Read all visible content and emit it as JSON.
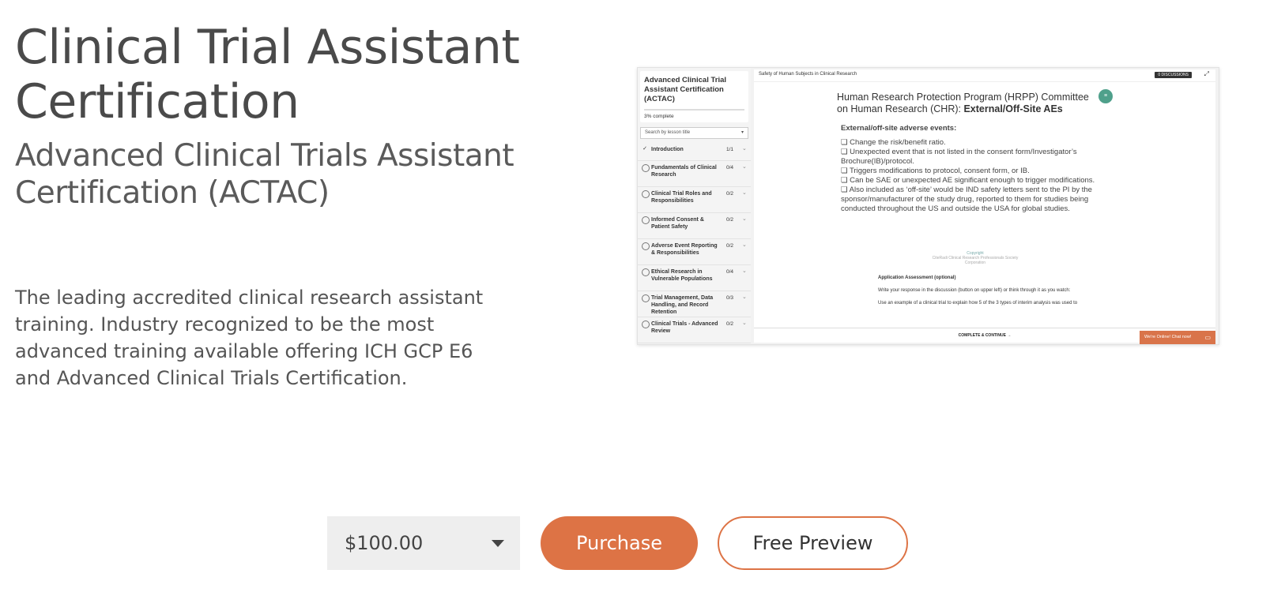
{
  "course": {
    "title": "Clinical Trial Assistant Certification",
    "subtitle": "Advanced Clinical Trials Assistant Certification (ACTAC)",
    "description": "The leading accredited clinical research assistant training. Industry recognized to be the most advanced training available offering ICH GCP E6 and Advanced Clinical Trials Certification."
  },
  "preview": {
    "sidebar_title": "Advanced Clinical Trial Assistant Certification (ACTAC)",
    "progress": "3% complete",
    "search_placeholder": "Search by lesson title",
    "lessons": [
      {
        "title": "Introduction",
        "count": "1/1",
        "done": true
      },
      {
        "title": "Fundamentals of Clinical Research",
        "count": "0/4",
        "done": false
      },
      {
        "title": "Clinical Trial Roles and Responsibilities",
        "count": "0/2",
        "done": false
      },
      {
        "title": "Informed Consent & Patient Safety",
        "count": "0/2",
        "done": false
      },
      {
        "title": "Adverse Event Reporting & Responsibilities",
        "count": "0/2",
        "done": false
      },
      {
        "title": "Ethical Research in Vulnerable Populations",
        "count": "0/4",
        "done": false
      },
      {
        "title": "Trial Management, Data Handling, and Record Retention",
        "count": "0/3",
        "done": false
      },
      {
        "title": "Clinical Trials - Advanced Review",
        "count": "0/2",
        "done": false
      }
    ],
    "panel_title": "Safety of Human Subjects in Clinical Research",
    "discussions_label": "0 DISCUSSIONS",
    "slide_heading_1": "Human Research Protection Program (HRPP) Committee",
    "slide_heading_2": "on Human Research (CHR): ",
    "slide_heading_bold": "External/Off-Site AEs",
    "slide_subheading": "External/off-site adverse events:",
    "bullets": [
      "❏ Change the risk/benefit ratio.",
      "❏ Unexpected event that is not listed in the consent form/Investigator’s Brochure(IB)/protocol.",
      "❏ Triggers modifications to protocol, consent form, or IB.",
      "❏ Can be SAE or unexpected AE significant enough to trigger modifications.",
      "❏ Also included as ‘off-site’ would be IND safety letters sent to the PI by the sponsor/manufacturer of the study drug, reported to them for studies being conducted throughout the US and outside the USA for global studies."
    ],
    "copyright_1": "Copyright",
    "copyright_2": "CiteRadi Clinical Research Professionals Society Corporation",
    "assessment_title": "Application Assessment (optional)",
    "assessment_line_1": "Write your response in the discussion (button on upper left) or think through it as you watch:",
    "assessment_line_2": "Use an example of a clinical trial to explain how 5 of the 3 types of interim analysis was used to",
    "continue_label": "COMPLETE & CONTINUE →",
    "chat_label": "We're Online! Chat now!"
  },
  "purchase": {
    "price": "$100.00",
    "purchase_label": "Purchase",
    "preview_label": "Free Preview"
  },
  "colors": {
    "accent": "#dd7345",
    "price_bg": "#eeeeee",
    "title_text": "#4a4a4a"
  }
}
